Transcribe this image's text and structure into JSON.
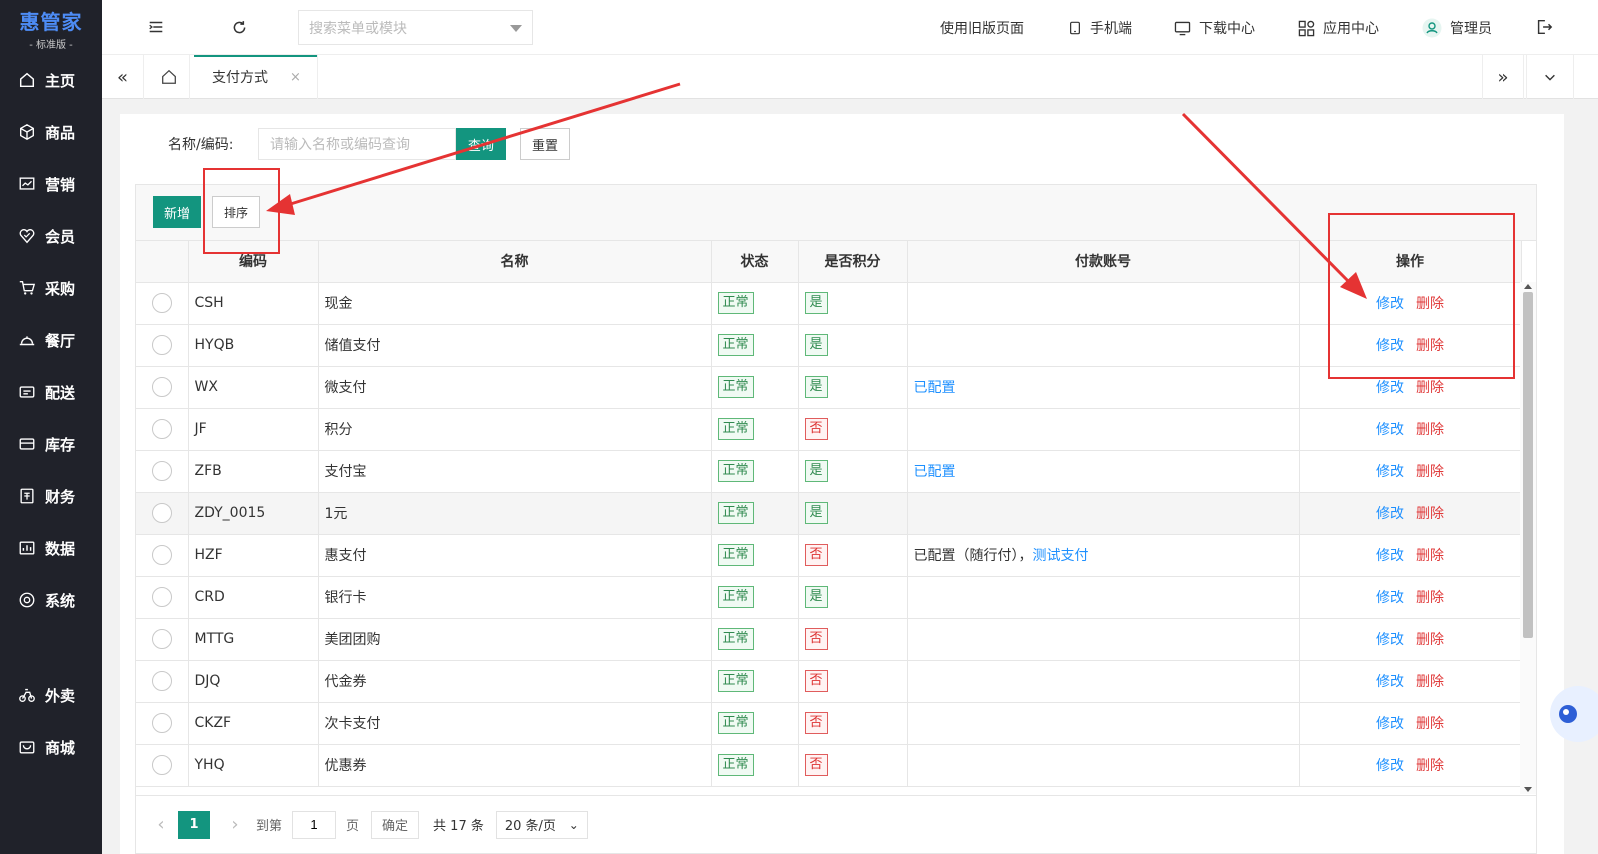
{
  "sidebar": {
    "brand": "惠管家",
    "edition": "- 标准版 -",
    "items": [
      {
        "label": "主页",
        "icon": "home-icon"
      },
      {
        "label": "商品",
        "icon": "box-icon"
      },
      {
        "label": "营销",
        "icon": "chart-icon"
      },
      {
        "label": "会员",
        "icon": "heart-icon"
      },
      {
        "label": "采购",
        "icon": "cart-icon"
      },
      {
        "label": "餐厅",
        "icon": "dish-icon"
      },
      {
        "label": "配送",
        "icon": "delivery-icon"
      },
      {
        "label": "库存",
        "icon": "warehouse-icon"
      },
      {
        "label": "财务",
        "icon": "finance-icon"
      },
      {
        "label": "数据",
        "icon": "data-icon"
      },
      {
        "label": "系统",
        "icon": "settings-icon"
      },
      {
        "label": "外卖",
        "icon": "bike-icon"
      },
      {
        "label": "商城",
        "icon": "store-icon"
      }
    ]
  },
  "topbar": {
    "search_placeholder": "搜索菜单或模块",
    "old_page": "使用旧版页面",
    "mobile": "手机端",
    "download": "下载中心",
    "apps": "应用中心",
    "user": "管理员"
  },
  "tabs": {
    "active": "支付方式",
    "close": "×"
  },
  "filter": {
    "label": "名称/编码:",
    "placeholder": "请输入名称或编码查询",
    "query": "查询",
    "reset": "重置"
  },
  "toolbar": {
    "add": "新增",
    "sort": "排序"
  },
  "table": {
    "headers": [
      "编码",
      "名称",
      "状态",
      "是否积分",
      "付款账号",
      "操作"
    ],
    "edit": "修改",
    "delete": "删除",
    "rows": [
      {
        "code": "CSH",
        "name": "现金",
        "status": "正常",
        "points": "是",
        "account": "",
        "account_link": ""
      },
      {
        "code": "HYQB",
        "name": "储值支付",
        "status": "正常",
        "points": "是",
        "account": "",
        "account_link": ""
      },
      {
        "code": "WX",
        "name": "微支付",
        "status": "正常",
        "points": "是",
        "account": "",
        "account_link": "已配置"
      },
      {
        "code": "JF",
        "name": "积分",
        "status": "正常",
        "points": "否",
        "account": "",
        "account_link": ""
      },
      {
        "code": "ZFB",
        "name": "支付宝",
        "status": "正常",
        "points": "是",
        "account": "",
        "account_link": "已配置"
      },
      {
        "code": "ZDY_0015",
        "name": "1元",
        "status": "正常",
        "points": "是",
        "account": "",
        "account_link": ""
      },
      {
        "code": "HZF",
        "name": "惠支付",
        "status": "正常",
        "points": "否",
        "account": "已配置（随行付），",
        "account_link": "测试支付"
      },
      {
        "code": "CRD",
        "name": "银行卡",
        "status": "正常",
        "points": "是",
        "account": "",
        "account_link": ""
      },
      {
        "code": "MTTG",
        "name": "美团团购",
        "status": "正常",
        "points": "否",
        "account": "",
        "account_link": ""
      },
      {
        "code": "DJQ",
        "name": "代金券",
        "status": "正常",
        "points": "否",
        "account": "",
        "account_link": ""
      },
      {
        "code": "CKZF",
        "name": "次卡支付",
        "status": "正常",
        "points": "否",
        "account": "",
        "account_link": ""
      },
      {
        "code": "YHQ",
        "name": "优惠券",
        "status": "正常",
        "points": "否",
        "account": "",
        "account_link": ""
      }
    ]
  },
  "pager": {
    "current": "1",
    "goto": "到第",
    "page_input": "1",
    "page_unit": "页",
    "confirm": "确定",
    "total": "共 17 条",
    "per_page": "20 条/页"
  },
  "colors": {
    "sidebar_bg": "#20222a",
    "primary": "#13957f",
    "link_blue": "#1e90ff",
    "link_red": "#e03b3b",
    "annotation_red": "#e53333"
  }
}
